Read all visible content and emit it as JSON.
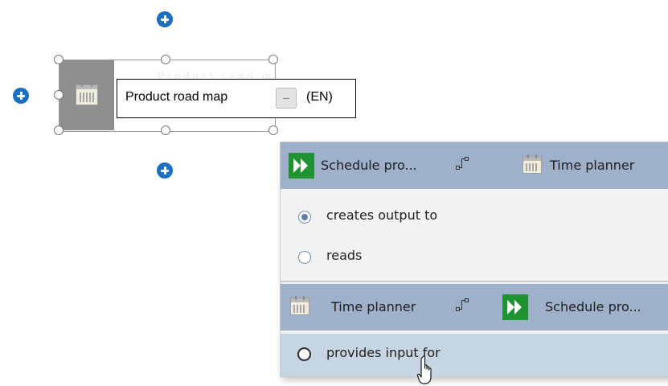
{
  "object": {
    "name": "Product road map",
    "language": "(EN)",
    "faded_hint": "Product road map",
    "icon": "calendar-icon"
  },
  "popup": {
    "sections": [
      {
        "header": {
          "source": "Schedule pro...",
          "source_icon": "process-step-icon",
          "target": "Time planner",
          "target_icon": "calendar-icon"
        },
        "options": [
          {
            "label": "creates output to",
            "selected": true
          },
          {
            "label": "reads",
            "selected": false
          }
        ]
      },
      {
        "header": {
          "source": "Time planner",
          "source_icon": "calendar-icon",
          "target": "Schedule pro...",
          "target_icon": "process-step-icon"
        },
        "options": [
          {
            "label": "provides input for",
            "selected": false,
            "hovered": true
          }
        ]
      }
    ]
  },
  "colors": {
    "plus_blue": "#1c6fc0",
    "header_bg": "#9fb0ca",
    "hover_bg": "#c7d4e2",
    "process_green": "#1f9331"
  }
}
